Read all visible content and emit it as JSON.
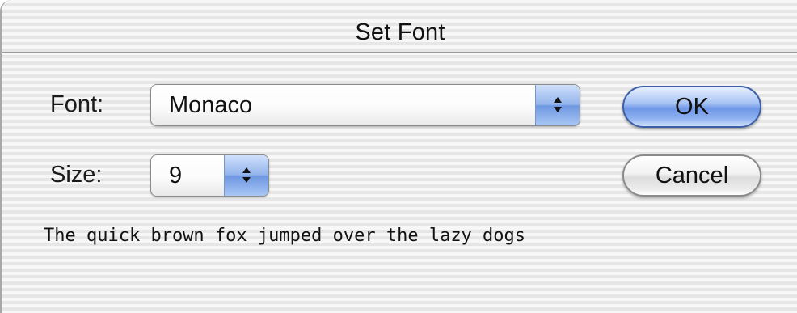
{
  "window": {
    "title": "Set Font"
  },
  "font": {
    "label": "Font:",
    "selected": "Monaco"
  },
  "size": {
    "label": "Size:",
    "selected": "9"
  },
  "buttons": {
    "ok_label": "OK",
    "cancel_label": "Cancel"
  },
  "preview": {
    "sample_text": "The quick brown fox jumped over the lazy dogs"
  },
  "colors": {
    "default_button": "#6f97e6",
    "popup_stepper": "#93b4ec"
  },
  "icons": {
    "popup_arrows": "up-down-arrows-icon"
  }
}
